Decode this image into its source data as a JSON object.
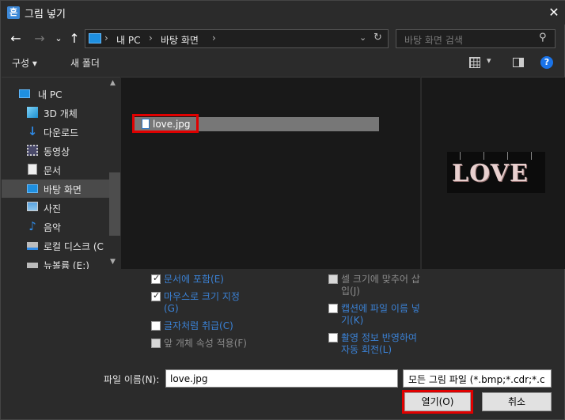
{
  "window": {
    "title": "그림 넣기",
    "app_icon_glyph": "흔"
  },
  "nav": {
    "back": "←",
    "forward": "→",
    "recent": "⌄",
    "up": "↑",
    "address": {
      "sep": "›",
      "crumbs": [
        "내 PC",
        "바탕 화면"
      ],
      "dropdown": "⌄",
      "refresh": "↻"
    },
    "search_placeholder": "바탕 화면 검색"
  },
  "toolbar": {
    "organize": "구성 ▾",
    "new_folder": "새 폴더",
    "view_dropdown": "▾",
    "help": "?"
  },
  "sidebar": {
    "items": [
      {
        "label": "내 PC",
        "icon": "pc-icon"
      },
      {
        "label": "3D 개체",
        "icon": "cube-icon"
      },
      {
        "label": "다운로드",
        "icon": "download-icon"
      },
      {
        "label": "동영상",
        "icon": "video-icon"
      },
      {
        "label": "문서",
        "icon": "document-icon"
      },
      {
        "label": "바탕 화면",
        "icon": "desktop-icon",
        "selected": true
      },
      {
        "label": "사진",
        "icon": "picture-icon"
      },
      {
        "label": "음악",
        "icon": "music-icon"
      },
      {
        "label": "로컬 디스크 (C",
        "icon": "disk-icon"
      },
      {
        "label": "뉴볼륨 (E:)",
        "icon": "drive-icon"
      }
    ]
  },
  "files": [
    {
      "name": "love.jpg",
      "selected": true
    }
  ],
  "preview": {
    "word": "LOVE"
  },
  "options": {
    "left": [
      {
        "label": "문서에 포함(E)",
        "checked": true
      },
      {
        "label": "마우스로 크기 지정",
        "label2": "(G)",
        "checked": true
      },
      {
        "label": "글자처럼 취급(C)",
        "checked": false
      },
      {
        "label": "앞 개체 속성 적용(F)",
        "checked": false,
        "disabled": true
      }
    ],
    "right": [
      {
        "label": "셀 크기에 맞추어 삽",
        "label2": "입(J)",
        "checked": false,
        "disabled": true
      },
      {
        "label": "캡션에 파일 이름 넣",
        "label2": "기(K)",
        "checked": false
      },
      {
        "label": "촬영 정보 반영하여",
        "label2": "자동 회전(L)",
        "checked": false
      }
    ]
  },
  "bottom": {
    "filename_label": "파일 이름(N):",
    "filename_value": "love.jpg",
    "filter": "모든 그림 파일 (*.bmp;*.cdr;*.c",
    "open": "열기(O)",
    "cancel": "취소"
  },
  "colors": {
    "highlight": "#e00000",
    "link_blue": "#3b82d6",
    "accent": "#1e8fe0"
  }
}
